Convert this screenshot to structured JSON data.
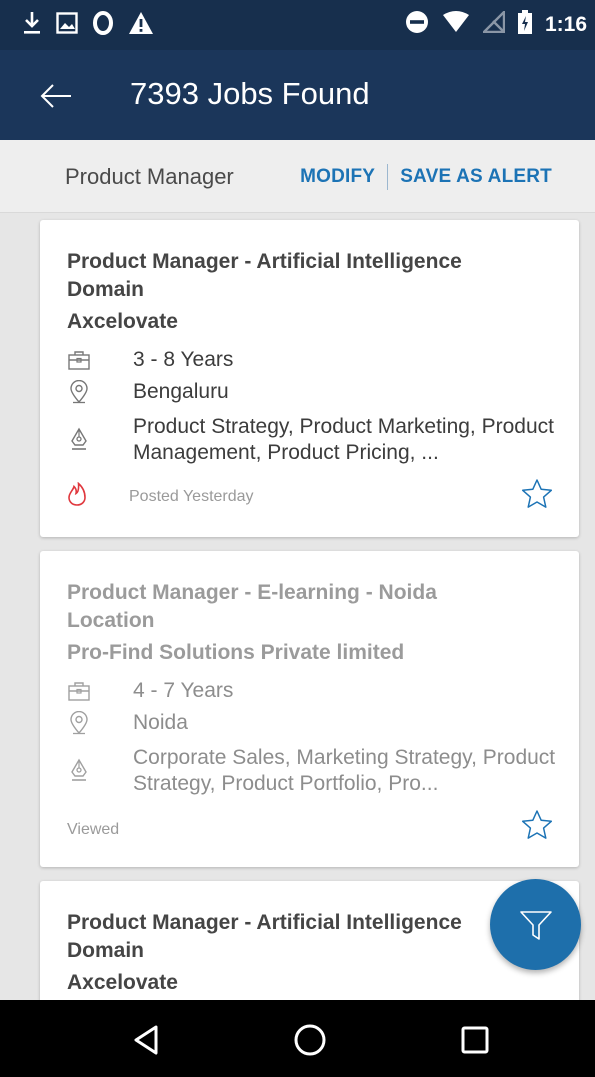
{
  "status_bar": {
    "time": "1:16",
    "icons": [
      "download-icon",
      "image-icon",
      "circle-icon",
      "warning-icon",
      "dnd-icon",
      "wifi-icon",
      "no-signal-icon",
      "battery-charging-icon"
    ]
  },
  "app_bar": {
    "title": "7393 Jobs Found",
    "back_icon": "arrow-left-icon"
  },
  "search": {
    "query": "Product Manager",
    "modify_label": "MODIFY",
    "save_alert_label": "SAVE AS ALERT"
  },
  "jobs": [
    {
      "title": "Product Manager - Artificial Intelligence Domain",
      "company": "Axcelovate",
      "experience": "3 - 8 Years",
      "location": "Bengaluru",
      "skills": "Product Strategy, Product Marketing, Product Management, Product Pricing, ...",
      "status": "Posted Yesterday",
      "status_icon": "flame-icon"
    },
    {
      "title": "Product Manager - E-learning - Noida Location",
      "company": "Pro-Find Solutions Private limited",
      "experience": "4 - 7 Years",
      "location": "Noida",
      "skills": "Corporate Sales, Marketing Strategy, Product Strategy, Product Portfolio, Pro...",
      "status": "Viewed"
    },
    {
      "title": "Product Manager - Artificial Intelligence Domain",
      "company": "Axcelovate"
    }
  ],
  "colors": {
    "status_bar": "#172f4d",
    "app_bar": "#1b365a",
    "accent": "#1c73b5",
    "fab": "#1e6fab",
    "hot": "#e0383e"
  }
}
